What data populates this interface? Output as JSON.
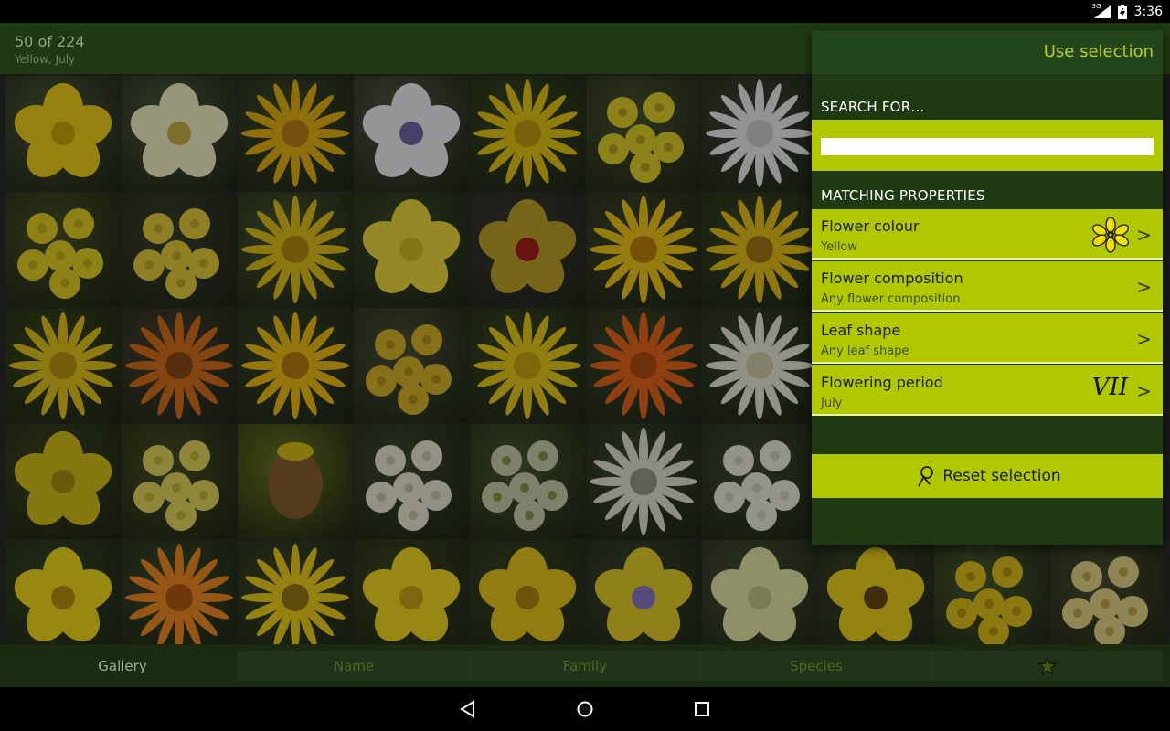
{
  "status_bar": {
    "network": "3G",
    "time": "3:36"
  },
  "header": {
    "counter": "50 of 224",
    "filter_summary": "Yellow, July"
  },
  "gallery": {
    "tiles": [
      {
        "bg": "#4e5a3a",
        "petal": "#f2d21a",
        "center": "#c7a80b",
        "kind": "cup"
      },
      {
        "bg": "#4d5b3e",
        "petal": "#f4f0c6",
        "center": "#c9b24a",
        "kind": "cup"
      },
      {
        "bg": "#3e4a28",
        "petal": "#e7b214",
        "center": "#b8821a",
        "kind": "daisy"
      },
      {
        "bg": "#555a4c",
        "petal": "#f3f3f6",
        "center": "#6f68a8",
        "kind": "cup"
      },
      {
        "bg": "#3b4a22",
        "petal": "#e8c814",
        "center": "#c0a012",
        "kind": "daisy"
      },
      {
        "bg": "#4c5630",
        "petal": "#e3d22a",
        "center": "#b9a221",
        "kind": "cluster"
      },
      {
        "bg": "#3f4536",
        "petal": "#eeeeee",
        "center": "#cfcfcf",
        "kind": "daisy"
      },
      {
        "bg": "#4a5526",
        "petal": "#e6d024",
        "center": "#c7b11a",
        "kind": "cluster"
      },
      {
        "bg": "#3b4230",
        "petal": "#e9cf3c",
        "center": "#c8a92a",
        "kind": "cluster"
      },
      {
        "bg": "#4a5a30",
        "petal": "#e3c21a",
        "center": "#b38d14",
        "kind": "daisy"
      },
      {
        "bg": "#3d4f28",
        "petal": "#f2dc3e",
        "center": "#d9bd22",
        "kind": "cup"
      },
      {
        "bg": "#3e3c36",
        "petal": "#c1a52a",
        "center": "#a81f1c",
        "kind": "cup"
      },
      {
        "bg": "#40482c",
        "petal": "#f2c818",
        "center": "#c2840f",
        "kind": "daisy"
      },
      {
        "bg": "#3a4a22",
        "petal": "#e8c21c",
        "center": "#a67713",
        "kind": "daisy"
      },
      {
        "bg": "#3c4a1e",
        "petal": "#e4c51c",
        "center": "#b89714",
        "kind": "daisy"
      },
      {
        "bg": "#4a4232",
        "petal": "#d6701c",
        "center": "#8a4d17",
        "kind": "daisy"
      },
      {
        "bg": "#3a4628",
        "petal": "#efbe14",
        "center": "#b27e10",
        "kind": "daisy"
      },
      {
        "bg": "#4a5238",
        "petal": "#d9b62a",
        "center": "#b0931e",
        "kind": "cluster"
      },
      {
        "bg": "#3c4a22",
        "petal": "#e9cc1a",
        "center": "#c9a812",
        "kind": "daisy"
      },
      {
        "bg": "#3f4a2c",
        "petal": "#e8661c",
        "center": "#b04b10",
        "kind": "daisy"
      },
      {
        "bg": "#3c4330",
        "petal": "#ecebd8",
        "center": "#d2cfa8",
        "kind": "daisy"
      },
      {
        "bg": "#3e4a20",
        "petal": "#d9c21a",
        "center": "#a89412",
        "kind": "cup"
      },
      {
        "bg": "#4a5224",
        "petal": "#e5d860",
        "center": "#c9b832",
        "kind": "cluster"
      },
      {
        "bg": "#6a7a20",
        "petal": "#8a6030",
        "center": "#d9c01a",
        "kind": "cone"
      },
      {
        "bg": "#3e4a30",
        "petal": "#ecebd6",
        "center": "#c9c8a8",
        "kind": "cluster"
      },
      {
        "bg": "#4a5a30",
        "petal": "#cfd0b0",
        "center": "#8a9a4a",
        "kind": "cluster"
      },
      {
        "bg": "#3c4a2c",
        "petal": "#e4e4d6",
        "center": "#9a9a86",
        "kind": "daisy"
      },
      {
        "bg": "#3f4a34",
        "petal": "#eeeede",
        "center": "#d2d2c0",
        "kind": "cluster"
      },
      {
        "bg": "#3a4a24",
        "petal": "#f2dc1a",
        "center": "#b7940f",
        "kind": "cup"
      },
      {
        "bg": "#3c4a28",
        "petal": "#f08c24",
        "center": "#b25b12",
        "kind": "daisy"
      },
      {
        "bg": "#3e4a26",
        "petal": "#efd11c",
        "center": "#9a7a12",
        "kind": "daisy"
      },
      {
        "bg": "#3e4a20",
        "petal": "#f4dc24",
        "center": "#caa716",
        "kind": "cup"
      },
      {
        "bg": "#3a4a24",
        "petal": "#e8c81c",
        "center": "#b08a12",
        "kind": "cup"
      },
      {
        "bg": "#3c4630",
        "petal": "#e8cf2a",
        "center": "#8a7ac4",
        "kind": "cup"
      },
      {
        "bg": "#4a5438",
        "petal": "#e6e8a8",
        "center": "#c6c88a",
        "kind": "cup"
      },
      {
        "bg": "#3e4a2a",
        "petal": "#f0d41c",
        "center": "#6a4a16",
        "kind": "cup"
      },
      {
        "bg": "#4a5a30",
        "petal": "#e2c21a",
        "center": "#b89412",
        "kind": "cluster"
      },
      {
        "bg": "#4a5030",
        "petal": "#e8d88a",
        "center": "#c4a84a",
        "kind": "cluster"
      }
    ]
  },
  "tabs": [
    {
      "label": "Gallery",
      "active": true
    },
    {
      "label": "Name",
      "active": false
    },
    {
      "label": "Family",
      "active": false
    },
    {
      "label": "Species",
      "active": false
    }
  ],
  "panel": {
    "use_selection_label": "Use selection",
    "search_label": "SEARCH FOR…",
    "search_value": "",
    "matching_label": "MATCHING PROPERTIES",
    "properties": [
      {
        "title": "Flower colour",
        "value": "Yellow",
        "icon": "yellow-flower-icon"
      },
      {
        "title": "Flower composition",
        "value": "Any flower composition",
        "icon": ""
      },
      {
        "title": "Leaf shape",
        "value": "Any leaf shape",
        "icon": ""
      },
      {
        "title": "Flowering period",
        "value": "July",
        "icon": "roman-numeral-vii-icon"
      }
    ],
    "chevron": ">",
    "numeral": "VII",
    "reset_label": "Reset selection"
  },
  "colors": {
    "accent": "#b1c800",
    "header": "#1f3a12"
  }
}
